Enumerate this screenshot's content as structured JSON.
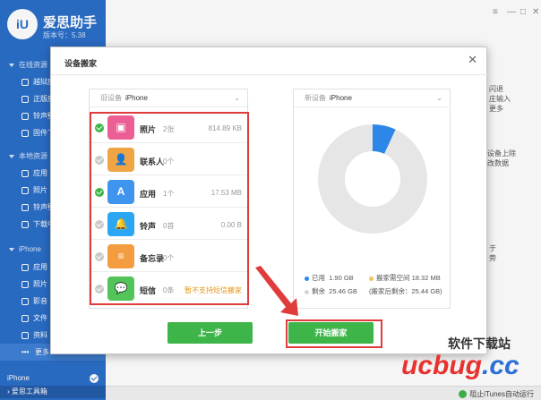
{
  "app": {
    "title": "爱思助手",
    "version": "版本号：5.38",
    "logo_text": "iU"
  },
  "sidebar": {
    "sections": [
      {
        "label": "在线资源"
      },
      {
        "label": "本地资源"
      },
      {
        "label": "iPhone"
      }
    ],
    "online_items": [
      "越狱应",
      "正版应",
      "铃声壁",
      "固件下"
    ],
    "local_items": [
      "应用",
      "照片",
      "铃声壁",
      "下载中"
    ],
    "iphone_items": [
      "应用",
      "照片",
      "影音",
      "文件",
      "资料",
      "更多"
    ],
    "bottom": {
      "device": "iPhone",
      "toolbox": "爱思工具箱"
    }
  },
  "background_text": {
    "right1": "闪退",
    "right2": "庄输入",
    "right3": "更多",
    "right4": "设备上除",
    "right5": "改数据",
    "right6": "于",
    "right7": "旁"
  },
  "window_controls": {
    "menu": "≡",
    "minimize": "—",
    "maximize": "□",
    "close": "✕"
  },
  "status": {
    "text": "阻止iTunes自动运行"
  },
  "dialog": {
    "title": "设备搬家",
    "close": "✕",
    "old_device": {
      "label": "旧设备",
      "value": "iPhone",
      "arrow": "⌄"
    },
    "new_device": {
      "label": "新设备",
      "value": "iPhone",
      "arrow": "⌄"
    },
    "items": [
      {
        "name": "照片",
        "count": "2张",
        "size": "814.89 KB",
        "checked": true,
        "icon": "photos-icon",
        "color": "#ec5f96"
      },
      {
        "name": "联系人",
        "count": "0个",
        "size": "",
        "checked": false,
        "icon": "contacts-icon",
        "color": "#f0a544"
      },
      {
        "name": "应用",
        "count": "1个",
        "size": "17.53 MB",
        "checked": true,
        "icon": "app-store-icon",
        "color": "#3f94ee"
      },
      {
        "name": "铃声",
        "count": "0首",
        "size": "0.00 B",
        "checked": false,
        "icon": "bell-icon",
        "color": "#2aa6f2"
      },
      {
        "name": "备忘录",
        "count": "0个",
        "size": "",
        "checked": false,
        "icon": "notes-icon",
        "color": "#f49d40"
      },
      {
        "name": "短信",
        "count": "0条",
        "size": "",
        "checked": false,
        "icon": "messages-icon",
        "color": "#52c45a",
        "warn": "暂不支持短信搬家"
      }
    ],
    "storage": {
      "used_label": "已用",
      "used_value": "1.90 GB",
      "needed_label": "搬家需空间",
      "needed_value": "18.32 MB",
      "free_label": "剩余",
      "free_value": "25.46 GB",
      "after_label": "(搬家后剩余：25.44 GB)",
      "used_fraction": 0.069,
      "colors": {
        "used": "#2d87e8",
        "needed": "#f3c25a",
        "free": "#e6e6e6"
      }
    },
    "buttons": {
      "prev": "上一步",
      "start": "开始搬家"
    }
  },
  "watermark": {
    "text1": "软件下载站",
    "text2": "ucbug",
    "text3": ".cc"
  }
}
